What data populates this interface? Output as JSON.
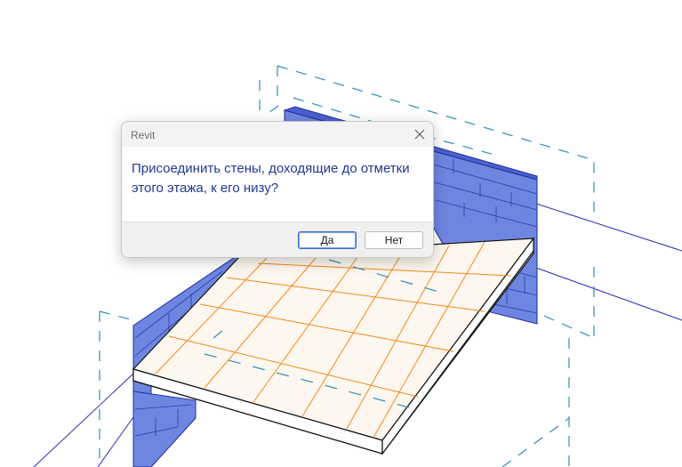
{
  "dialog": {
    "title": "Revit",
    "message": "Присоединить стены, доходящие до отметки этого этажа, к его низу?",
    "buttons": {
      "yes_label": "Да",
      "no_label": "Нет"
    },
    "close_icon": "close-icon"
  },
  "viewport": {
    "objects": [
      "wall-left",
      "wall-right",
      "floor-slab",
      "floor-grid",
      "level-bounds"
    ]
  },
  "colors": {
    "wall_fill": "#6f86e0",
    "wall_edge": "#1f2e9e",
    "grid_orange": "#f08a1c",
    "dash_cyan": "#2c8fb6",
    "guide_blue": "#2a2ab8",
    "message_text": "#1f3a93"
  }
}
